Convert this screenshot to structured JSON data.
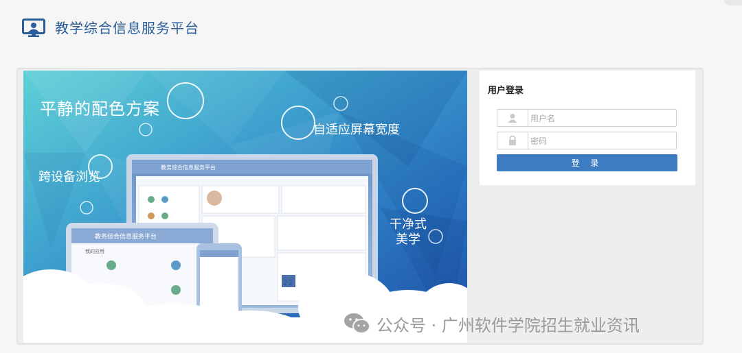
{
  "header": {
    "title": "教学综合信息服务平台",
    "logo_icon": "monitor-user-icon"
  },
  "banner": {
    "headline_1": "平静的配色方案",
    "headline_2": "自适应屏幕宽度",
    "headline_3": "跨设备浏览",
    "headline_4": "干净式美学",
    "monitor_title": "教务综合信息服务平台",
    "tablet_title": "教务综合信息服务平台",
    "tablet_section": "我的应用",
    "calendar_day": "22",
    "colors": {
      "top_left": "#52cad4",
      "mid": "#2a7bc4",
      "bottom_right": "#1e4fa5"
    }
  },
  "login": {
    "title": "用户登录",
    "username_placeholder": "用户名",
    "password_placeholder": "密码",
    "submit_label": "登 录",
    "user_icon": "user-icon",
    "lock_icon": "lock-icon",
    "button_color": "#3e7cc2"
  },
  "watermark": {
    "text": "公众号 · 广州软件学院招生就业资讯",
    "icon": "wechat-icon"
  }
}
